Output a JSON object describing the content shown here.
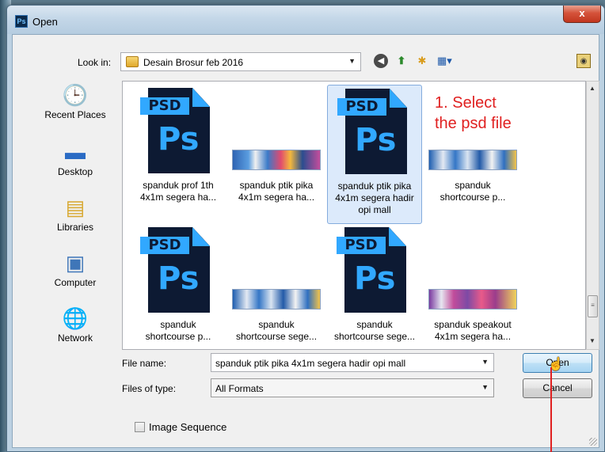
{
  "window": {
    "title": "Open",
    "app_icon": "Ps",
    "close_label": "x"
  },
  "toolbar": {
    "look_in_label": "Look in:",
    "look_in_value": "Desain Brosur feb 2016",
    "icons": [
      "back-icon",
      "up-folder-icon",
      "new-folder-icon",
      "views-menu-icon",
      "folder-options-icon"
    ]
  },
  "places": [
    {
      "label": "Recent Places",
      "icon": "recent-places-icon"
    },
    {
      "label": "Desktop",
      "icon": "desktop-icon"
    },
    {
      "label": "Libraries",
      "icon": "libraries-icon"
    },
    {
      "label": "Computer",
      "icon": "computer-icon"
    },
    {
      "label": "Network",
      "icon": "network-icon"
    }
  ],
  "files": [
    {
      "thumb": "psd",
      "line1": "spanduk prof 1th",
      "line2": "4x1m segera ha...",
      "line3": "",
      "selected": false
    },
    {
      "thumb": "banner",
      "line1": "spanduk ptik pika",
      "line2": "4x1m segera ha...",
      "line3": "",
      "selected": false
    },
    {
      "thumb": "psd",
      "line1": "spanduk ptik pika",
      "line2": "4x1m segera hadir",
      "line3": "opi mall",
      "selected": true
    },
    {
      "thumb": "banner-alt",
      "line1": "spanduk",
      "line2": "shortcourse p...",
      "line3": "",
      "selected": false
    },
    {
      "thumb": "psd",
      "line1": "spanduk",
      "line2": "shortcourse p...",
      "line3": "",
      "selected": false
    },
    {
      "thumb": "banner-alt",
      "line1": "spanduk",
      "line2": "shortcourse sege...",
      "line3": "",
      "selected": false
    },
    {
      "thumb": "psd",
      "line1": "spanduk",
      "line2": "shortcourse sege...",
      "line3": "",
      "selected": false
    },
    {
      "thumb": "banner-pink",
      "line1": "spanduk speakout",
      "line2": "4x1m segera ha...",
      "line3": "",
      "selected": false
    }
  ],
  "psd_badge": "PSD",
  "psd_glyph": "Ps",
  "annotation": {
    "line1": "1. Select",
    "line2": "the psd file",
    "color": "#e02020"
  },
  "form": {
    "file_name_label": "File name:",
    "file_name_value": "spanduk ptik pika 4x1m segera hadir opi mall",
    "file_type_label": "Files of type:",
    "file_type_value": "All Formats",
    "open_label": "Open",
    "cancel_label": "Cancel",
    "image_sequence_label": "Image Sequence",
    "image_sequence_checked": false
  }
}
